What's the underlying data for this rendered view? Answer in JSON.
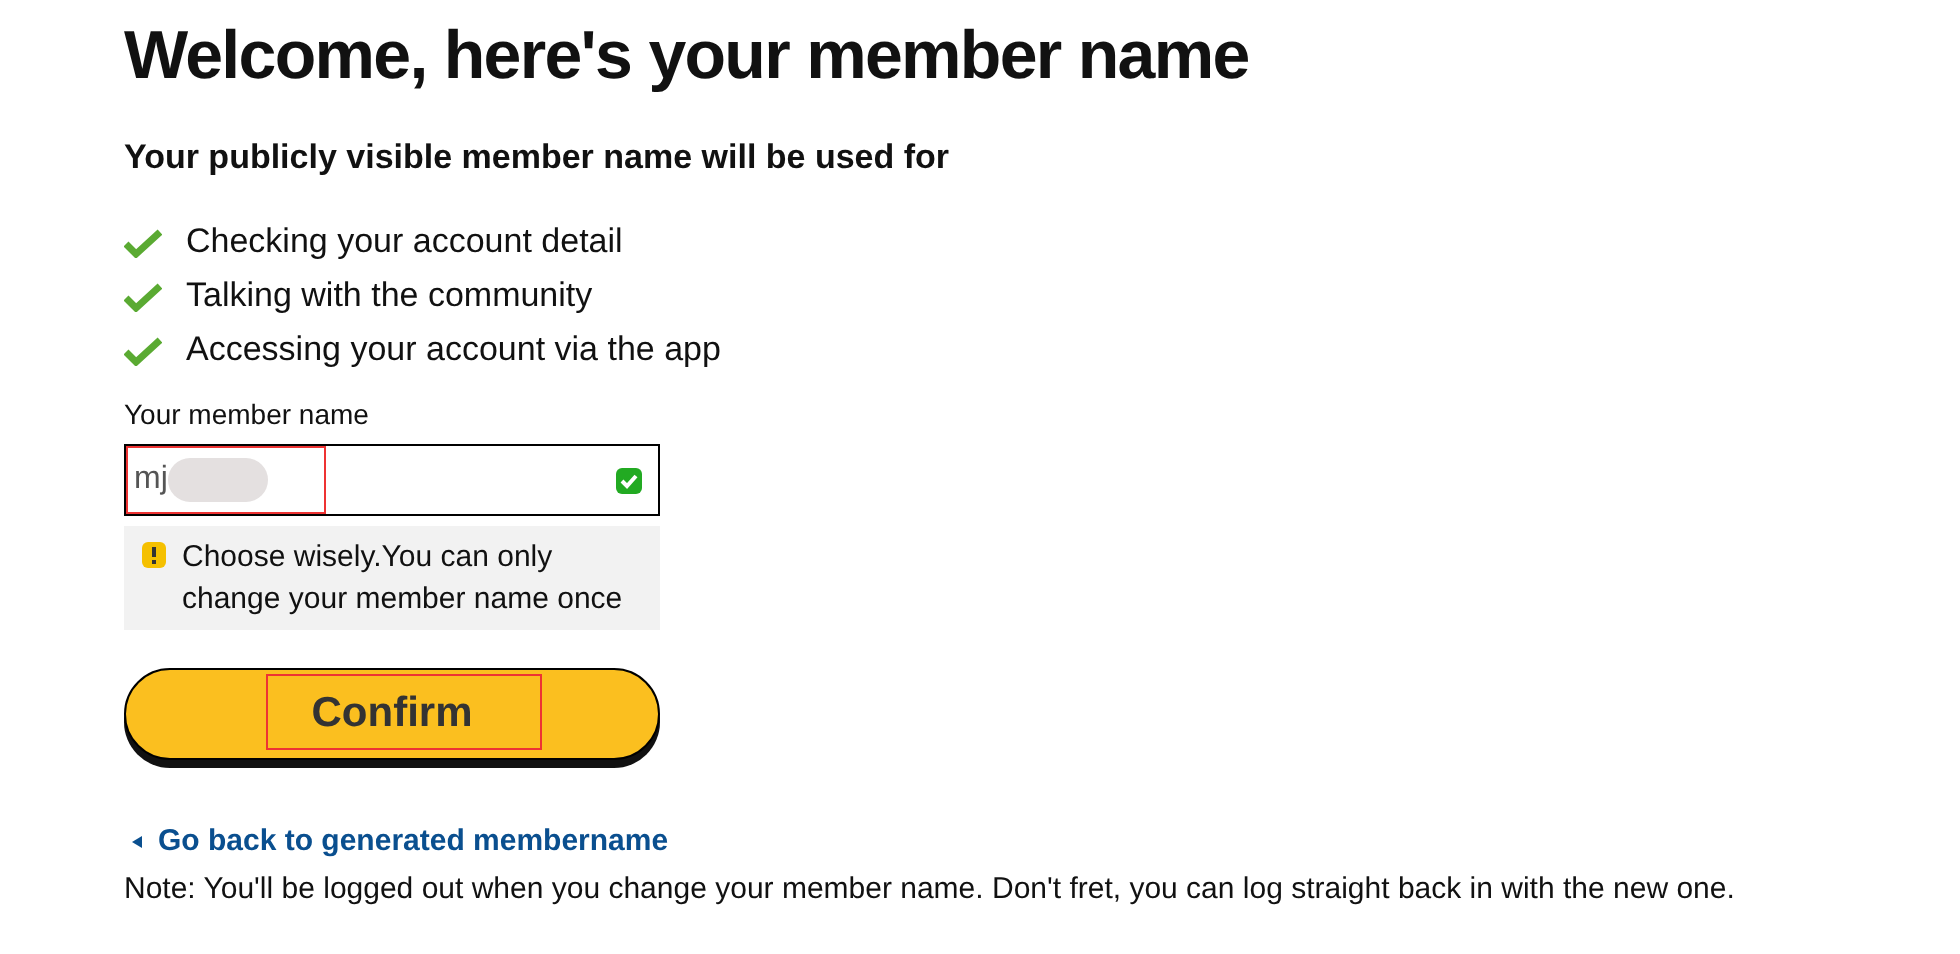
{
  "title": "Welcome, here's your member name",
  "subtitle": "Your publicly visible member name will be used for",
  "uses": [
    {
      "text": "Checking your account detail"
    },
    {
      "text": "Talking with the community"
    },
    {
      "text": "Accessing your account via the app"
    }
  ],
  "member_name": {
    "label": "Your member name",
    "value": "mj",
    "valid": true
  },
  "notice": {
    "text": "Choose wisely.You can only change your member name once"
  },
  "confirm_button": "Confirm",
  "back_link": "Go back to generated membername",
  "note": "Note: You'll be logged out when you change your member name. Don't fret, you can log straight back in with the new one."
}
